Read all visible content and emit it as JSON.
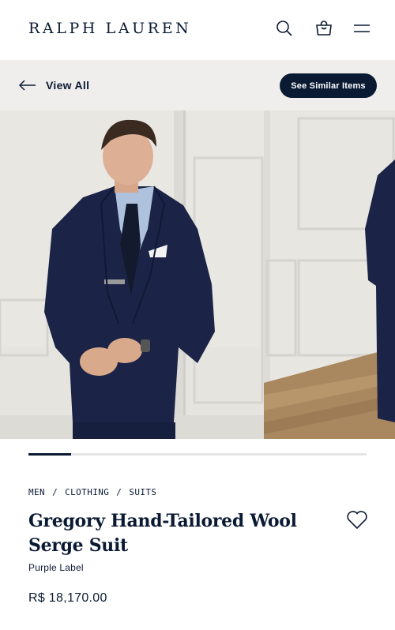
{
  "header": {
    "logo": "RALPH LAUREN",
    "icons": [
      "search-icon",
      "shopping-bag-icon",
      "menu-icon"
    ]
  },
  "subbar": {
    "back_label": "View All",
    "similar_button": "See Similar Items"
  },
  "gallery": {
    "images": [
      "model-front-view",
      "model-side-view"
    ],
    "progress": 0.125
  },
  "product": {
    "breadcrumb": [
      "MEN",
      "CLOTHING",
      "SUITS"
    ],
    "breadcrumb_separator": "/",
    "title": "Gregory Hand-Tailored Wool Serge Suit",
    "brand_line": "Purple Label",
    "price": "R$ 18,170.00"
  },
  "colors": {
    "navy": "#0b1a33",
    "subbar_bg": "#efeeec",
    "progress_track": "#e5e5e5"
  }
}
